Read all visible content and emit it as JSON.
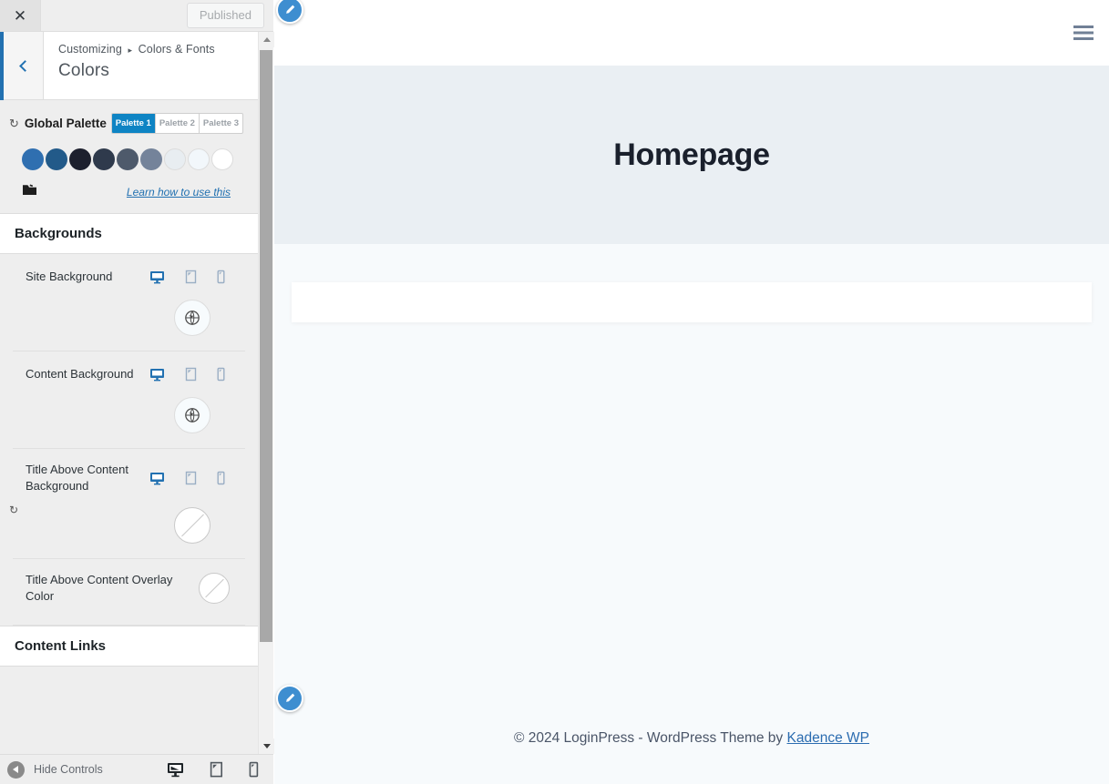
{
  "customizer": {
    "close_label": "Close",
    "publish_label": "Published",
    "breadcrumb_root": "Customizing",
    "breadcrumb_sep": "▸",
    "breadcrumb_parent": "Colors & Fonts",
    "panel_title": "Colors",
    "back_label": "Back",
    "global_palette": {
      "label": "Global Palette",
      "reset_icon": "↺",
      "tabs": [
        {
          "label": "Palette 1",
          "active": true
        },
        {
          "label": "Palette 2",
          "active": false
        },
        {
          "label": "Palette 3",
          "active": false
        }
      ],
      "swatches": [
        "#2f6fb0",
        "#225a89",
        "#1d202e",
        "#2f3a4c",
        "#4e5a6b",
        "#74839a",
        "#e8edf1",
        "#f2f7fb",
        "#ffffff"
      ],
      "folder_icon": "🗀",
      "learn_link": "Learn how to use this"
    },
    "sections": [
      {
        "title": "Backgrounds",
        "controls": [
          {
            "label": "Site Background",
            "has_reset": false,
            "devices": [
              "desktop",
              "tablet",
              "mobile"
            ],
            "active_device": "desktop",
            "swatch_type": "global",
            "swatch_color": "#f7fbfd"
          },
          {
            "label": "Content Background",
            "has_reset": false,
            "devices": [
              "desktop",
              "tablet",
              "mobile"
            ],
            "active_device": "desktop",
            "swatch_type": "global",
            "swatch_color": "#f7fbfd"
          },
          {
            "label": "Title Above Content Background",
            "has_reset": true,
            "devices": [
              "desktop",
              "tablet",
              "mobile"
            ],
            "active_device": "desktop",
            "swatch_type": "empty",
            "swatch_color": "transparent"
          },
          {
            "label": "Title Above Content Overlay Color",
            "has_reset": false,
            "devices": [],
            "active_device": "",
            "swatch_type": "empty",
            "swatch_color": "transparent"
          }
        ]
      },
      {
        "title": "Content Links",
        "controls": []
      }
    ],
    "footer": {
      "hide_controls_label": "Hide Controls",
      "devices": [
        "desktop",
        "tablet",
        "mobile"
      ],
      "active_device": "desktop"
    }
  },
  "preview": {
    "menu_icon": "hamburger-menu",
    "hero_title": "Homepage",
    "footer": {
      "text_before": "© 2024 LoginPress - WordPress Theme by ",
      "link_text": "Kadence WP"
    },
    "edit_shortcut_label": "Edit"
  },
  "colors": {
    "accent_blue": "#2271b1",
    "tab_active_blue": "#0e84c4",
    "pin_blue": "#3e8ed0",
    "hero_bg": "#eaeff3",
    "page_bg": "#f7fafc",
    "sidebar_bg": "#eeeeee"
  }
}
